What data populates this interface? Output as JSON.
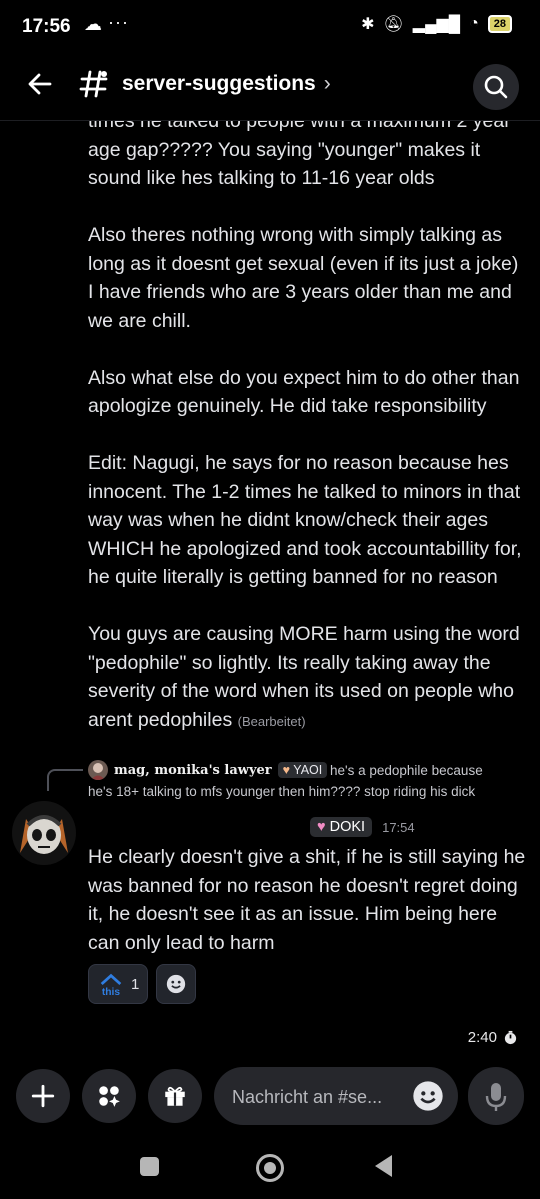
{
  "status_bar": {
    "time": "17:56",
    "more": "···",
    "battery": "28"
  },
  "header": {
    "channel": "server-suggestions",
    "chevron": "›"
  },
  "message_partial": {
    "cut_line": "times he talked to people with a maximum 2 year",
    "paragraphs": [
      "age gap????? You saying \"younger\" makes it sound like hes talking to 11-16 year olds",
      "Also theres nothing wrong with simply talking as long as it doesnt get sexual (even if its just a joke) I have friends who are 3 years older than me and we are chill.",
      "Also what else do you expect him to do other than apologize genuinely. He did take responsibility",
      "Edit: Nagugi, he says for no reason because hes innocent. The 1-2 times he talked to minors in that way was when he didnt know/check their ages WHICH he apologized and took accountabillity for, he quite literally is getting banned for no reason",
      "You guys are causing MORE harm using the word \"pedophile\" so lightly. Its really taking away the severity of the word when its used on people who arent pedophiles"
    ],
    "edited_label": "(Bearbeitet)"
  },
  "reply": {
    "author": "mag, monika's lawyer",
    "tag": "YAOI",
    "text_line1": "he's a pedophile because",
    "text_line2": "he's 18+ talking to mfs younger then him???? stop riding his dick"
  },
  "message": {
    "role_badge": "DOKI",
    "timestamp": "17:54",
    "text": "He clearly doesn't give a shit, if he is still saying he was banned for no reason he doesn't regret doing it, he doesn't see it as an issue. Him being here can only lead to harm",
    "reaction": {
      "emoji_label": "this",
      "count": "1"
    }
  },
  "duration": "2:40",
  "composer": {
    "placeholder": "Nachricht an #se..."
  },
  "colors": {
    "accent_blue": "#2f7de0",
    "heart_pink": "#f08cc4",
    "tag_heart": "#f7b98b"
  }
}
